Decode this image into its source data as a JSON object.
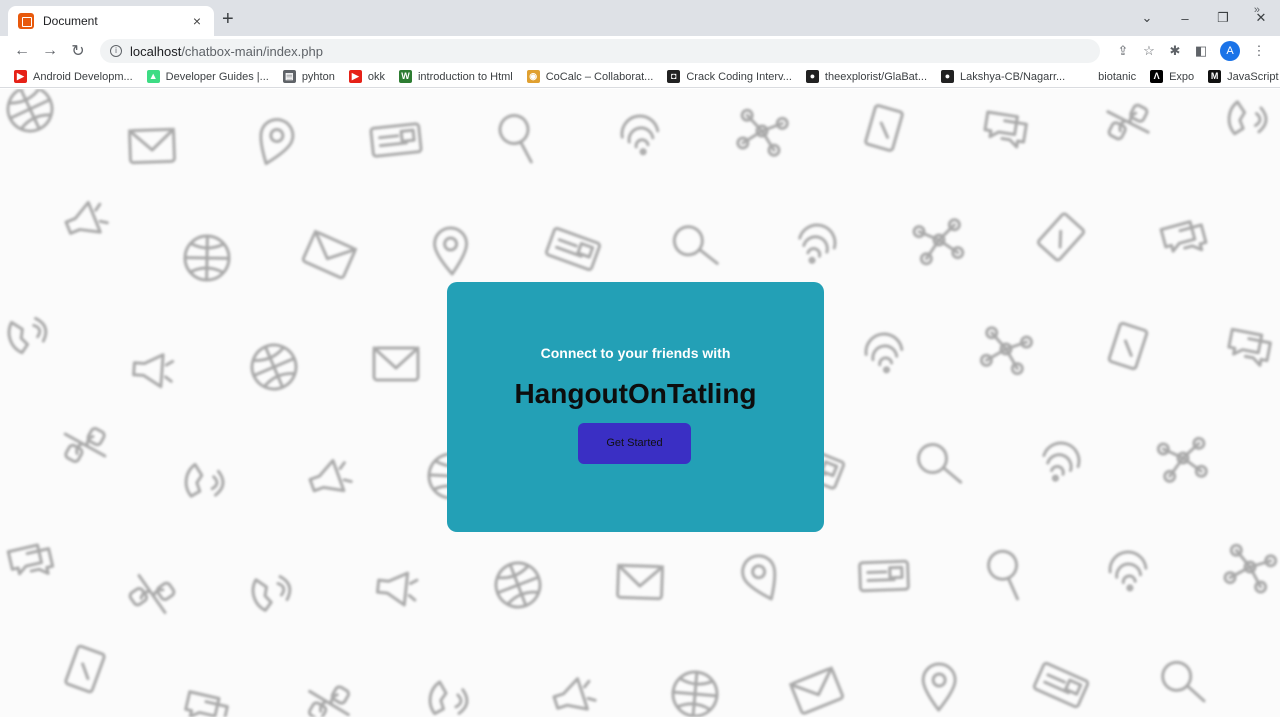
{
  "browser": {
    "tab_title": "Document",
    "tab_close": "×",
    "new_tab": "+",
    "url_host": "localhost",
    "url_path": "/chatbox-main/index.php",
    "window_controls": [
      "⌄",
      "–",
      "❐",
      "✕"
    ]
  },
  "bookmarks": [
    {
      "label": "Android Developm...",
      "icon": "youtube-icon",
      "color": "#e62117"
    },
    {
      "label": "Developer Guides |...",
      "icon": "android-icon",
      "color": "#3ddc84"
    },
    {
      "label": "pyhton",
      "icon": "doc-icon",
      "color": "#5f6368"
    },
    {
      "label": "okk",
      "icon": "youtube-icon",
      "color": "#e62117"
    },
    {
      "label": "introduction to Html",
      "icon": "w-icon",
      "color": "#2e7d32"
    },
    {
      "label": "CoCalc – Collaborat...",
      "icon": "cocalc-icon",
      "color": "#e0a030"
    },
    {
      "label": "Crack Coding Interv...",
      "icon": "cc-icon",
      "color": "#222"
    },
    {
      "label": "theexplorist/GlaBat...",
      "icon": "github-icon",
      "color": "#222"
    },
    {
      "label": "Lakshya-CB/Nagarr...",
      "icon": "github-icon",
      "color": "#222"
    },
    {
      "label": "biotanic",
      "icon": "blank-icon",
      "color": "#ffffff"
    },
    {
      "label": "Expo",
      "icon": "expo-icon",
      "color": "#000"
    },
    {
      "label": "JavaScript | MDN",
      "icon": "mdn-icon",
      "color": "#111"
    }
  ],
  "bookmarks_more": "»",
  "avatar_letter": "A",
  "card": {
    "subtitle": "Connect to your friends with",
    "brand": "HangoutOnTatling",
    "cta_label": "Get Started"
  },
  "colors": {
    "card_bg": "#23a0b6",
    "cta_bg": "#3a2fc4"
  }
}
